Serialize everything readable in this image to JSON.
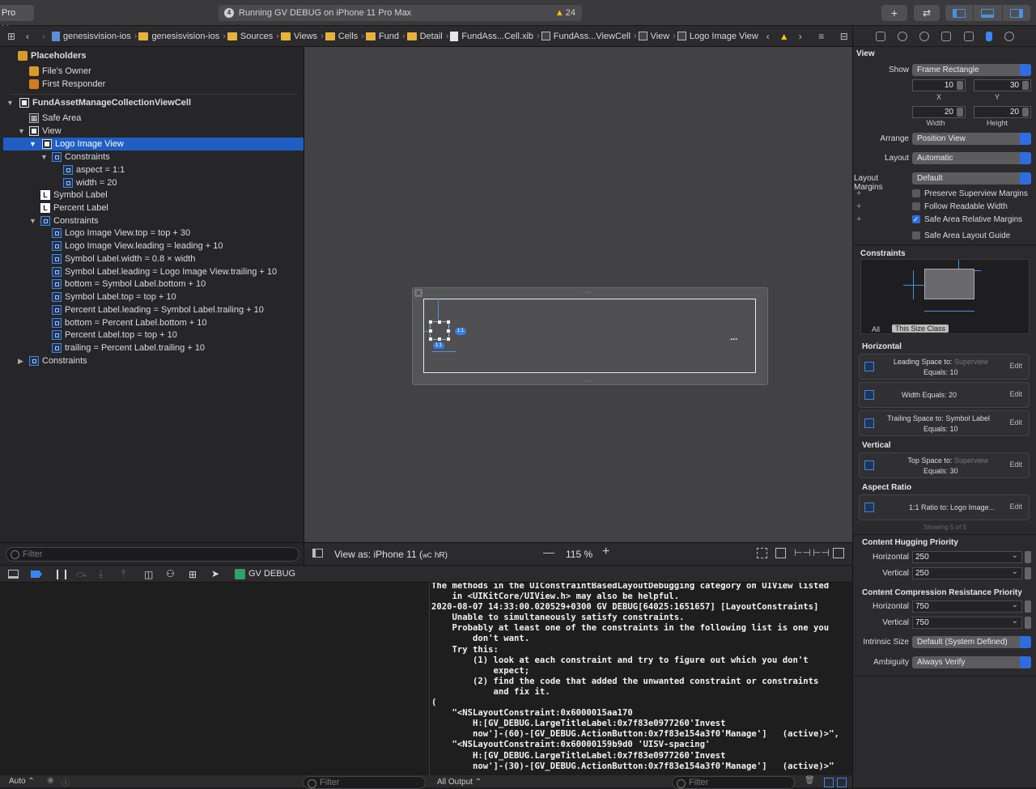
{
  "toolbar": {
    "scheme": "Pro Max",
    "status_badge": "4",
    "status_text": "Running GV DEBUG on iPhone 11 Pro Max",
    "warnings": "24"
  },
  "jumpbar": {
    "crumbs": [
      "genesisvision-ios",
      "genesisvision-ios",
      "Sources",
      "Views",
      "Cells",
      "Fund",
      "Detail",
      "FundAss...Cell.xib",
      "FundAss...ViewCell",
      "View",
      "Logo Image View"
    ]
  },
  "outline": {
    "placeholders": "Placeholders",
    "files_owner": "File's Owner",
    "first_responder": "First Responder",
    "cell": "FundAssetManageCollectionViewCell",
    "safe_area": "Safe Area",
    "view": "View",
    "logo": "Logo Image View",
    "constraints": "Constraints",
    "aspect": "aspect = 1:1",
    "width": "width = 20",
    "symbol_label": "Symbol Label",
    "percent_label": "Percent Label",
    "view_constraints": "Constraints",
    "view_constraint_items": [
      "Logo Image View.top = top + 30",
      "Logo Image View.leading = leading + 10",
      "Symbol Label.width = 0.8 × width",
      "Symbol Label.leading = Logo Image View.trailing + 10",
      "bottom = Symbol Label.bottom + 10",
      "Symbol Label.top = top + 10",
      "Percent Label.leading = Symbol Label.trailing + 10",
      "bottom = Percent Label.bottom + 10",
      "Percent Label.top = top + 10",
      "trailing = Percent Label.trailing + 10"
    ],
    "cell_constraints": "Constraints",
    "filter_placeholder": "Filter"
  },
  "canvas": {
    "view_as": "View as: iPhone 11 (",
    "size_class_w": "wC",
    "size_class_h": "hR)",
    "zoom": "115 %",
    "ratio_badge": "1:1",
    "ellipsis": "..."
  },
  "debug": {
    "target": "GV DEBUG"
  },
  "console": {
    "lines": [
      "The methods in the UIConstraintBasedLayoutDebugging category on UIView listed",
      "    in <UIKitCore/UIView.h> may also be helpful.",
      "2020-08-07 14:33:00.020529+0300 GV DEBUG[64025:1651657] [LayoutConstraints]",
      "    Unable to simultaneously satisfy constraints.",
      "    Probably at least one of the constraints in the following list is one you",
      "        don't want.",
      "    Try this:",
      "        (1) look at each constraint and try to figure out which you don't",
      "            expect;",
      "        (2) find the code that added the unwanted constraint or constraints",
      "            and fix it.",
      "(",
      "    \"<NSLayoutConstraint:0x6000015aa170",
      "        H:[GV_DEBUG.LargeTitleLabel:0x7f83e0977260'Invest",
      "        now']-(60)-[GV_DEBUG.ActionButton:0x7f83e154a3f0'Manage']   (active)>\",",
      "    \"<NSLayoutConstraint:0x60000159b9d0 'UISV-spacing'",
      "        H:[GV_DEBUG.LargeTitleLabel:0x7f83e0977260'Invest",
      "        now']-(30)-[GV_DEBUG.ActionButton:0x7f83e154a3f0'Manage']   (active)>\""
    ]
  },
  "bottom": {
    "auto": "Auto",
    "filter": "Filter",
    "all_output": "All Output",
    "filter2": "Filter"
  },
  "inspector": {
    "view_title": "View",
    "show_label": "Show",
    "show_value": "Frame Rectangle",
    "x": "10",
    "y": "30",
    "width": "20",
    "height": "20",
    "x_cap": "X",
    "y_cap": "Y",
    "w_cap": "Width",
    "h_cap": "Height",
    "arrange_label": "Arrange",
    "arrange_value": "Position View",
    "layout_label": "Layout",
    "layout_value": "Automatic",
    "margins_label": "Layout Margins",
    "margins_value": "Default",
    "preserve": "Preserve Superview Margins",
    "readable": "Follow Readable Width",
    "safe_rel": "Safe Area Relative Margins",
    "safe_guide": "Safe Area Layout Guide",
    "constraints_title": "Constraints",
    "tab_all": "All",
    "tab_size_class": "This Size Class",
    "horizontal_title": "Horizontal",
    "c1_label": "Leading Space to:",
    "c1_target": "Superview",
    "c1_eq": "Equals:",
    "c1_val": "10",
    "c2_label": "Width Equals:",
    "c2_val": "20",
    "c3_label": "Trailing Space to:",
    "c3_target": "Symbol Label",
    "c3_eq": "Equals:",
    "c3_val": "10",
    "vertical_title": "Vertical",
    "c4_label": "Top Space to:",
    "c4_target": "Superview",
    "c4_eq": "Equals:",
    "c4_val": "30",
    "aspect_title": "Aspect Ratio",
    "c5_label": "1:1 Ratio to:",
    "c5_target": "Logo Image...",
    "edit": "Edit",
    "showing": "Showing 5 of 5",
    "hugging_title": "Content Hugging Priority",
    "h_label": "Horizontal",
    "h_val": "250",
    "v_label": "Vertical",
    "v_val": "250",
    "compression_title": "Content Compression Resistance Priority",
    "ch_label": "Horizontal",
    "ch_val": "750",
    "cv_label": "Vertical",
    "cv_val": "750",
    "intrinsic_label": "Intrinsic Size",
    "intrinsic_value": "Default (System Defined)",
    "ambiguity_label": "Ambiguity",
    "ambiguity_value": "Always Verify"
  }
}
